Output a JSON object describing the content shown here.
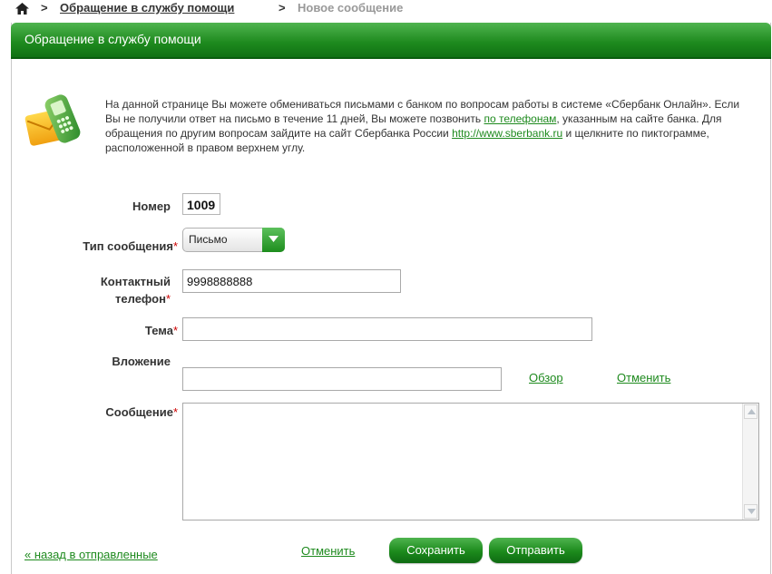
{
  "breadcrumb": {
    "separator": ">",
    "parent": "Обращение в службу помощи",
    "current": "Новое сообщение"
  },
  "panel": {
    "title": "Обращение в службу помощи"
  },
  "intro": {
    "text1": "На данной странице Вы можете обмениваться письмами с банком по вопросам работы в системе «Сбербанк Онлайн». Если Вы не получили ответ на письмо в течение 11 дней, Вы можете позвонить ",
    "phone_link": "по телефонам",
    "text2": ", указанным на сайте банка. Для обращения по другим вопросам зайдите на сайт Сбербанка России ",
    "site_link": "http://www.sberbank.ru",
    "text3": " и щелкните по пиктограмме, расположенной в правом верхнем углу."
  },
  "form": {
    "number_label": "Номер",
    "number_value": "1009",
    "type_label": "Тип сообщения",
    "type_value": "Письмо",
    "phone_label_line1": "Контактный",
    "phone_label_line2": "телефон",
    "phone_value": "9998888888",
    "topic_label": "Тема",
    "topic_value": "",
    "attachment_label": "Вложение",
    "attachment_value": "",
    "browse_link": "Обзор",
    "cancel_attachment_link": "Отменить",
    "message_label": "Сообщение",
    "message_value": "",
    "required_mark": "*"
  },
  "footer": {
    "back_link": "« назад в отправленные",
    "cancel_link": "Отменить",
    "save_button": "Сохранить",
    "send_button": "Отправить"
  },
  "colors": {
    "accent": "#1e8a1e",
    "required": "#cc0000"
  },
  "icons": [
    "home-icon",
    "phone-envelope-icon",
    "chevron-down-icon",
    "scroll-up-icon",
    "scroll-down-icon"
  ]
}
